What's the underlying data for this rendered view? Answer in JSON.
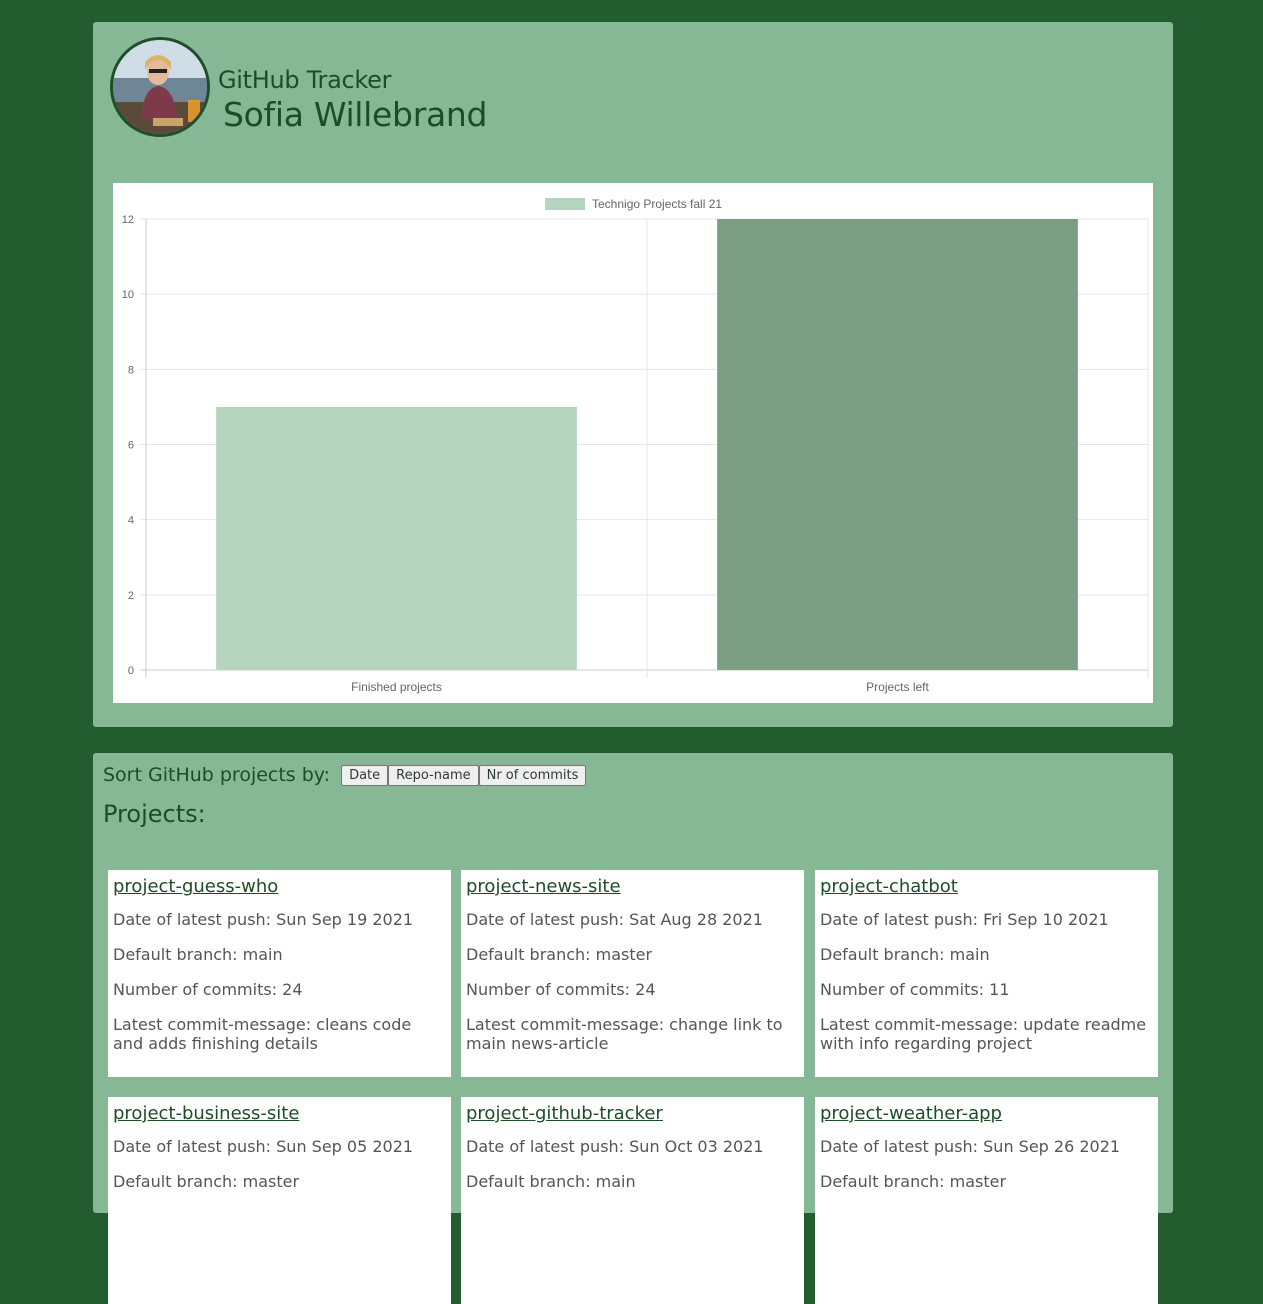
{
  "header": {
    "app_title": "GitHub Tracker",
    "user_name": "Sofia Willebrand"
  },
  "chart_data": {
    "type": "bar",
    "categories": [
      "Finished projects",
      "Projects left"
    ],
    "series": [
      {
        "name": "Technigo Projects fall 21",
        "values": [
          7,
          12
        ]
      }
    ],
    "ylim": [
      0,
      12
    ],
    "yticks": [
      0,
      2,
      4,
      6,
      8,
      10,
      12
    ],
    "legend": "top-center",
    "grid": true,
    "colors": [
      "#b5d5bf",
      "#7c9e82"
    ]
  },
  "sort": {
    "label": "Sort GitHub projects by:",
    "buttons": [
      "Date",
      "Repo-name",
      "Nr of commits"
    ]
  },
  "projects": {
    "heading": "Projects:",
    "items": [
      {
        "name": "project-guess-who",
        "date": "Date of latest push: Sun Sep 19 2021",
        "branch": "Default branch: main",
        "commits": "Number of commits: 24",
        "message": "Latest commit-message: cleans code and adds finishing details"
      },
      {
        "name": "project-news-site",
        "date": "Date of latest push: Sat Aug 28 2021",
        "branch": "Default branch: master",
        "commits": "Number of commits: 24",
        "message": "Latest commit-message: change link to main news-article"
      },
      {
        "name": "project-chatbot",
        "date": "Date of latest push: Fri Sep 10 2021",
        "branch": "Default branch: main",
        "commits": "Number of commits: 11",
        "message": "Latest commit-message: update readme with info regarding project"
      },
      {
        "name": "project-business-site",
        "date": "Date of latest push: Sun Sep 05 2021",
        "branch": "Default branch: master",
        "commits": "",
        "message": ""
      },
      {
        "name": "project-github-tracker",
        "date": "Date of latest push: Sun Oct 03 2021",
        "branch": "Default branch: main",
        "commits": "",
        "message": ""
      },
      {
        "name": "project-weather-app",
        "date": "Date of latest push: Sun Sep 26 2021",
        "branch": "Default branch: master",
        "commits": "",
        "message": ""
      }
    ]
  }
}
